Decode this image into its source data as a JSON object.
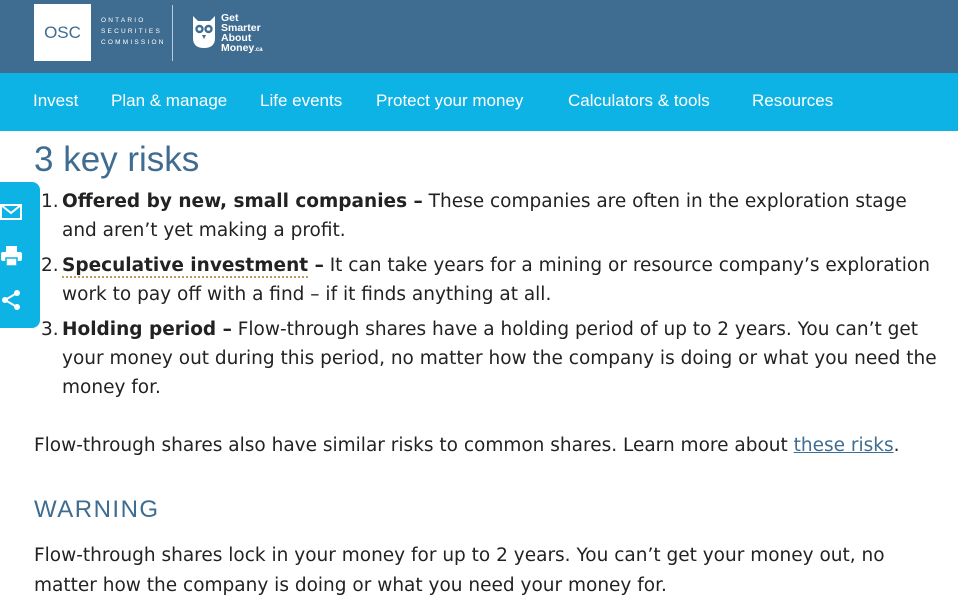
{
  "header": {
    "osc_logo": "OSC",
    "osc_name": [
      "ONTARIO",
      "SECURITIES",
      "COMMISSION"
    ],
    "gsam_lines": [
      "Get",
      "Smarter",
      "About",
      "Money"
    ],
    "gsam_suffix": ".ca"
  },
  "nav": {
    "items": [
      {
        "label": "Invest"
      },
      {
        "label": "Plan & manage"
      },
      {
        "label": "Life events"
      },
      {
        "label": "Protect your money"
      },
      {
        "label": "Calculators & tools"
      },
      {
        "label": "Resources"
      }
    ]
  },
  "share": {
    "icons": [
      "email-icon",
      "print-icon",
      "share-icon"
    ]
  },
  "content": {
    "title": "3 key risks",
    "risks": [
      {
        "num": "1.",
        "term": "Offered by new, small companies –",
        "text": " These companies are often in the exploration stage and aren’t yet making a profit."
      },
      {
        "num": "2.",
        "term": "Speculative investment",
        "dash": " –",
        "text": " It can take years for a mining or resource company’s exploration work to pay off with a find – if it finds anything at all."
      },
      {
        "num": "3.",
        "term": "Holding period –",
        "text": " Flow-through shares have a holding period of up to 2 years. You can’t get your money out during this period, no matter how the company is doing or what you need the money for."
      }
    ],
    "para1_before": "Flow-through shares also have similar risks to common shares. Learn more about ",
    "para1_link": "these risks",
    "para1_after": ".",
    "warning_heading": "WARNING",
    "warning_text": "Flow-through shares lock in your money for up to 2 years. You can’t get your money out, no matter how the company is doing or what you need your money for."
  },
  "colors": {
    "header_bg": "#3f6c91",
    "nav_bg": "#0db3e5",
    "heading": "#3f6c91"
  }
}
